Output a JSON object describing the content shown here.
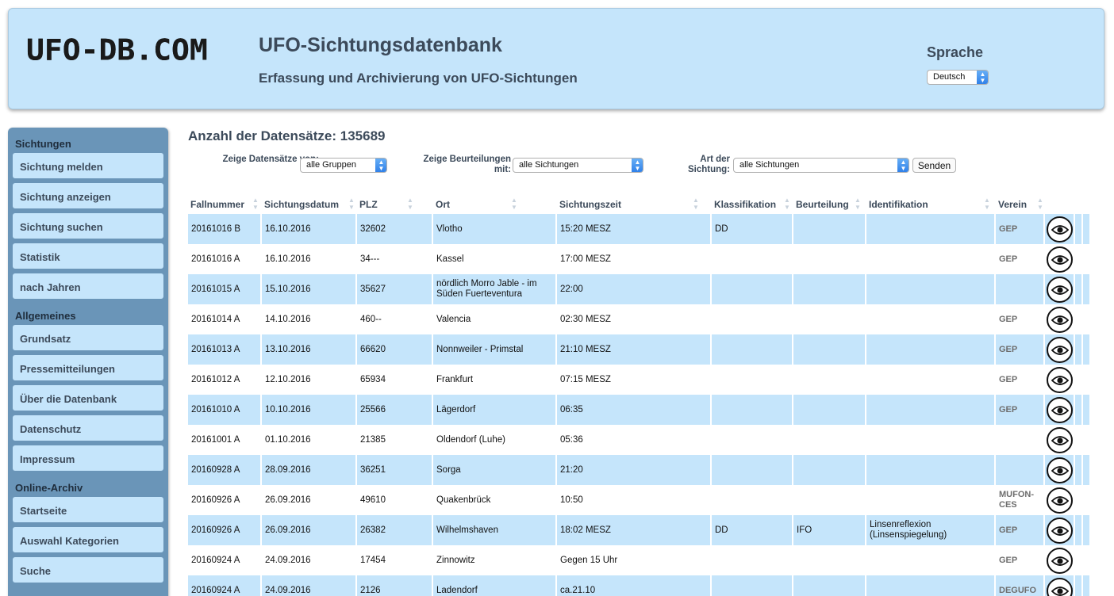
{
  "header": {
    "logo": "UFO-DB.COM",
    "title": "UFO-Sichtungsdatenbank",
    "subtitle": "Erfassung und Archivierung von UFO-Sichtungen",
    "language_label": "Sprache",
    "language_value": "Deutsch"
  },
  "sidebar": {
    "sections": [
      {
        "title": "Sichtungen",
        "items": [
          "Sichtung melden",
          "Sichtung anzeigen",
          "Sichtung suchen",
          "Statistik",
          "nach Jahren"
        ]
      },
      {
        "title": "Allgemeines",
        "items": [
          "Grundsatz",
          "Pressemitteilungen",
          "Über die Datenbank",
          "Datenschutz",
          "Impressum"
        ]
      },
      {
        "title": "Online-Archiv",
        "items": [
          "Startseite",
          "Auswahl Kategorien",
          "Suche"
        ]
      }
    ]
  },
  "main": {
    "count_label": "Anzahl der Datensätze: 135689",
    "filters": {
      "groups_label": "Zeige Datensätze von:",
      "groups_value": "alle Gruppen",
      "rating_label": "Zeige Beurteilungen mit:",
      "rating_value": "alle Sichtungen",
      "type_label": "Art der Sichtung:",
      "type_value": "alle Sichtungen",
      "submit_label": "Senden"
    }
  },
  "table": {
    "columns": [
      "Fallnummer",
      "Sichtungsdatum",
      "PLZ",
      "Ort",
      "Sichtungszeit",
      "Klassifikation",
      "Beurteilung",
      "Identifikation",
      "Verein"
    ],
    "rows": [
      [
        "20161016 B",
        "16.10.2016",
        "32602",
        "Vlotho",
        "15:20 MESZ",
        "DD",
        "",
        "",
        "GEP"
      ],
      [
        "20161016 A",
        "16.10.2016",
        "34---",
        "Kassel",
        "17:00 MESZ",
        "",
        "",
        "",
        "GEP"
      ],
      [
        "20161015 A",
        "15.10.2016",
        "35627",
        "nördlich Morro Jable - im Süden Fuerteventura",
        "22:00",
        "",
        "",
        "",
        ""
      ],
      [
        "20161014 A",
        "14.10.2016",
        "460--",
        "Valencia",
        "02:30 MESZ",
        "",
        "",
        "",
        "GEP"
      ],
      [
        "20161013 A",
        "13.10.2016",
        "66620",
        "Nonnweiler - Primstal",
        "21:10 MESZ",
        "",
        "",
        "",
        "GEP"
      ],
      [
        "20161012 A",
        "12.10.2016",
        "65934",
        "Frankfurt",
        "07:15 MESZ",
        "",
        "",
        "",
        "GEP"
      ],
      [
        "20161010 A",
        "10.10.2016",
        "25566",
        "Lägerdorf",
        "06:35",
        "",
        "",
        "",
        "GEP"
      ],
      [
        "20161001 A",
        "01.10.2016",
        "21385",
        "Oldendorf (Luhe)",
        "05:36",
        "",
        "",
        "",
        ""
      ],
      [
        "20160928 A",
        "28.09.2016",
        "36251",
        "Sorga",
        "21:20",
        "",
        "",
        "",
        ""
      ],
      [
        "20160926 A",
        "26.09.2016",
        "49610",
        "Quakenbrück",
        "10:50",
        "",
        "",
        "",
        "MUFON-CES"
      ],
      [
        "20160926 A",
        "26.09.2016",
        "26382",
        "Wilhelmshaven",
        "18:02 MESZ",
        "DD",
        "IFO",
        "Linsenreflexion (Linsenspiegelung)",
        "GEP"
      ],
      [
        "20160924 A",
        "24.09.2016",
        "17454",
        "Zinnowitz",
        "Gegen 15 Uhr",
        "",
        "",
        "",
        "GEP"
      ],
      [
        "20160924 A",
        "24.09.2016",
        "2126",
        "Ladendorf",
        "ca.21.10",
        "",
        "",
        "",
        "DEGUFO"
      ]
    ],
    "row_icon": "eye-icon"
  },
  "colors": {
    "header_bg": "#c5e5fb",
    "sidebar_bg": "#6a95b8",
    "row_alt": "#c5e5fb",
    "text": "#3c4a5a"
  }
}
